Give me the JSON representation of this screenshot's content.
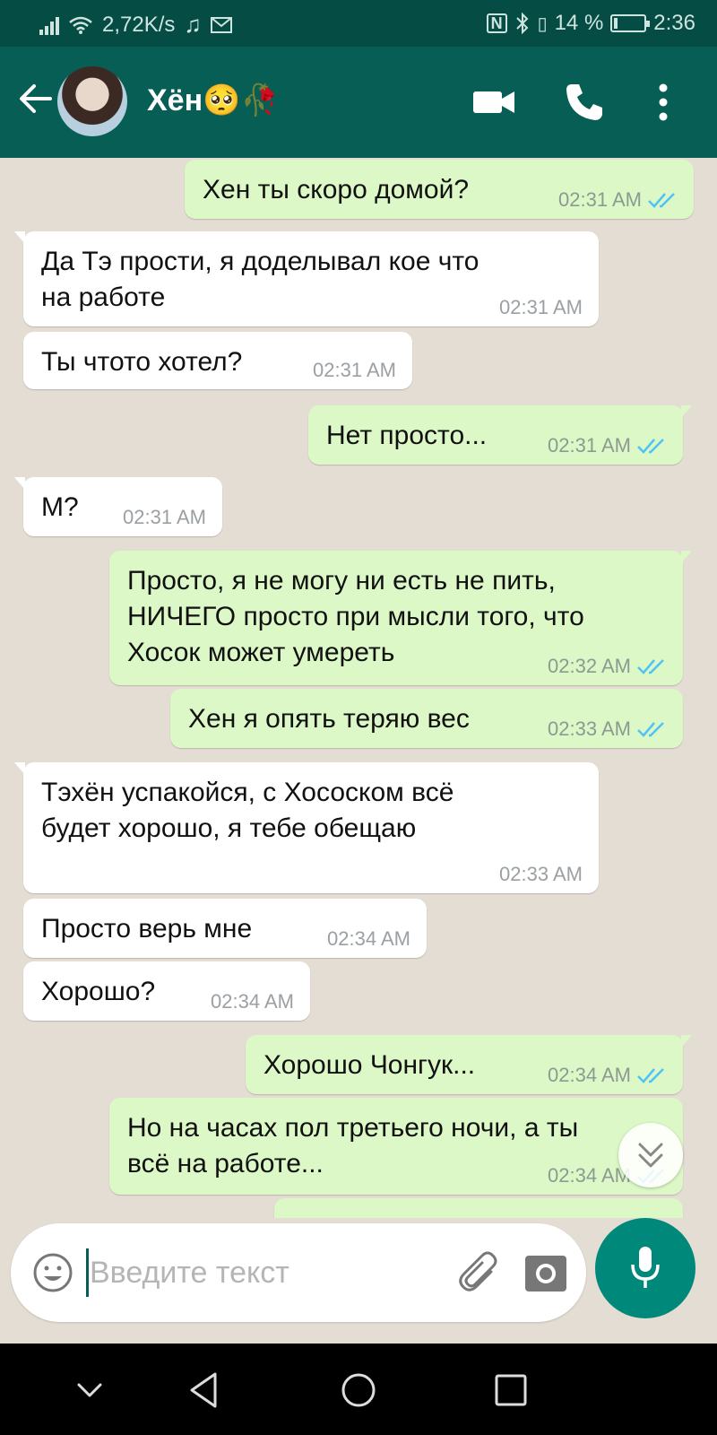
{
  "status_bar": {
    "speed": "2,72K/s",
    "battery": "14 %",
    "battery_fraction": 0.14,
    "time": "2:36"
  },
  "header": {
    "contact_name": "Хён🥺🥀",
    "icons": [
      "back-arrow-icon",
      "video-call-icon",
      "voice-call-icon",
      "more-options-icon"
    ]
  },
  "messages": [
    {
      "dir": "out",
      "lines": [
        "Хен ты скоро домой?"
      ],
      "time": "02:31 AM"
    },
    {
      "dir": "in",
      "lines": [
        "Да Тэ прости, я доделывал кое что",
        "на работе"
      ],
      "time": "02:31 AM"
    },
    {
      "dir": "in",
      "lines": [
        "Ты чтото хотел?"
      ],
      "time": "02:31 AM"
    },
    {
      "dir": "out",
      "lines": [
        "Нет просто..."
      ],
      "time": "02:31 AM"
    },
    {
      "dir": "in",
      "lines": [
        "М?"
      ],
      "time": "02:31 AM"
    },
    {
      "dir": "out",
      "lines": [
        "Просто, я не могу ни есть не пить,",
        "НИЧЕГО просто при мысли того, что",
        "Хосок может умереть"
      ],
      "time": "02:32 AM"
    },
    {
      "dir": "out",
      "lines": [
        "Хен я опять теряю вес"
      ],
      "time": "02:33 AM"
    },
    {
      "dir": "in",
      "lines": [
        "Тэхён успакойся, с Хососком всё",
        "будет хорошо, я тебе обещаю"
      ],
      "time": "02:33 AM"
    },
    {
      "dir": "in",
      "lines": [
        "Просто верь мне"
      ],
      "time": "02:34 AM"
    },
    {
      "dir": "in",
      "lines": [
        "Хорошо?"
      ],
      "time": "02:34 AM"
    },
    {
      "dir": "out",
      "lines": [
        "Хорошо Чонгук..."
      ],
      "time": "02:34 AM"
    },
    {
      "dir": "out",
      "lines": [
        "Но на часах пол третьего ночи, а ты",
        "всё на работе..."
      ],
      "time": "02:34 AM"
    }
  ],
  "input": {
    "placeholder": "Введите текст"
  },
  "colors": {
    "header": "#075e54",
    "status_bar": "#054d44",
    "outgoing_bubble": "#dcf8c6",
    "incoming_bubble": "#ffffff",
    "read_ticks": "#4fc3f7",
    "mic_button": "#00897b"
  }
}
